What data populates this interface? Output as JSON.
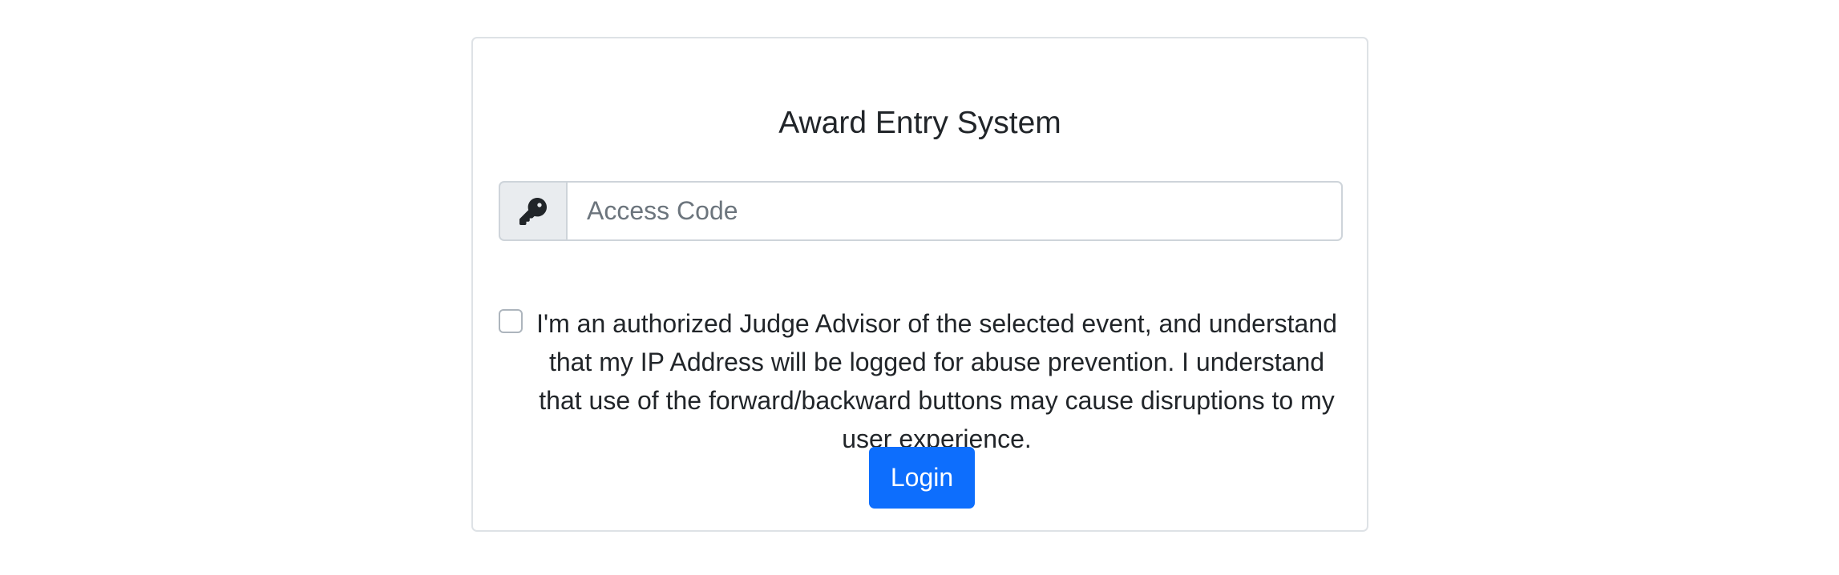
{
  "login_card": {
    "title": "Award Entry System",
    "access_code": {
      "icon": "key-icon",
      "value": "",
      "placeholder": "Access Code"
    },
    "consent": {
      "checked": false,
      "text": "I'm an authorized Judge Advisor of the selected event, and understand that my IP Address will be logged for abuse prevention. I understand that use of the forward/backward buttons may cause disruptions to my user experience."
    },
    "login_button": {
      "label": "Login"
    }
  },
  "colors": {
    "accent": "#0d6efd",
    "border": "#dee2e6",
    "input_border": "#ced4da",
    "addon_background": "#e9ecef",
    "placeholder": "#6c757d",
    "text": "#212529"
  }
}
